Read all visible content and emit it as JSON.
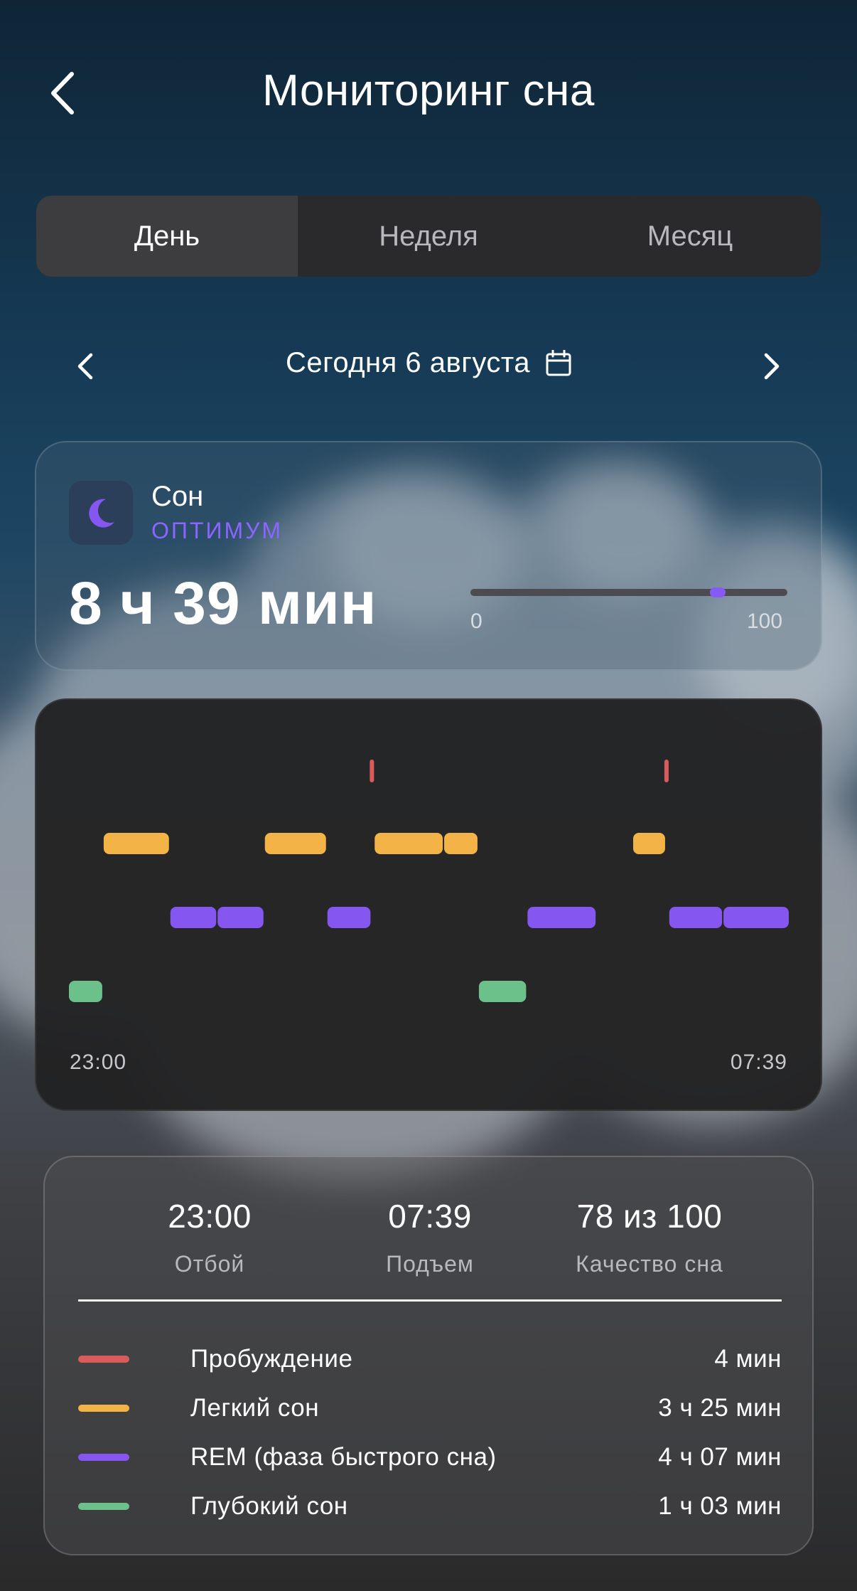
{
  "header": {
    "title": "Мониторинг сна"
  },
  "tabs": [
    {
      "label": "День",
      "active": true
    },
    {
      "label": "Неделя",
      "active": false
    },
    {
      "label": "Месяц",
      "active": false
    }
  ],
  "date_nav": {
    "label": "Сегодня 6 августа"
  },
  "sleep_summary": {
    "label": "Сон",
    "status": "ОПТИМУМ",
    "duration": "8 ч 39 мин",
    "scale_min": "0",
    "scale_max": "100",
    "quality_value": 78
  },
  "chart_data": {
    "type": "bar",
    "x_start": "23:00",
    "x_end": "07:39",
    "stages": [
      "Пробуждение",
      "Легкий сон",
      "REM (фаза быстрого сна)",
      "Глубокий сон"
    ],
    "segments": [
      {
        "stage": 3,
        "start": "23:00",
        "end": "23:25"
      },
      {
        "stage": 1,
        "start": "23:25",
        "end": "24:13"
      },
      {
        "stage": 2,
        "start": "24:13",
        "end": "24:47"
      },
      {
        "stage": 2,
        "start": "24:47",
        "end": "25:21"
      },
      {
        "stage": 1,
        "start": "25:21",
        "end": "26:06"
      },
      {
        "stage": 2,
        "start": "26:06",
        "end": "26:38"
      },
      {
        "stage": 0,
        "start": "26:38",
        "end": "26:40"
      },
      {
        "stage": 1,
        "start": "26:40",
        "end": "27:30"
      },
      {
        "stage": 1,
        "start": "27:30",
        "end": "27:55"
      },
      {
        "stage": 3,
        "start": "27:55",
        "end": "28:30"
      },
      {
        "stage": 2,
        "start": "28:30",
        "end": "29:20"
      },
      {
        "stage": 1,
        "start": "29:46",
        "end": "30:10"
      },
      {
        "stage": 0,
        "start": "30:10",
        "end": "30:12"
      },
      {
        "stage": 2,
        "start": "30:12",
        "end": "30:51"
      },
      {
        "stage": 2,
        "start": "30:51",
        "end": "31:39"
      }
    ],
    "colors": [
      "#d95b5b",
      "#f3b346",
      "#8557f0",
      "#6cc08a"
    ]
  },
  "stats": {
    "bedtime": {
      "value": "23:00",
      "label": "Отбой"
    },
    "wakeup": {
      "value": "07:39",
      "label": "Подъем"
    },
    "quality": {
      "value": "78 из 100",
      "label": "Качество сна"
    }
  },
  "legend": [
    {
      "label": "Пробуждение",
      "value": "4 мин",
      "color": "#d95b5b"
    },
    {
      "label": "Легкий сон",
      "value": "3 ч 25 мин",
      "color": "#f3b346"
    },
    {
      "label": "REM (фаза быстрого сна)",
      "value": "4 ч 07 мин",
      "color": "#8557f0"
    },
    {
      "label": "Глубокий сон",
      "value": "1 ч 03 мин",
      "color": "#6cc08a"
    }
  ]
}
